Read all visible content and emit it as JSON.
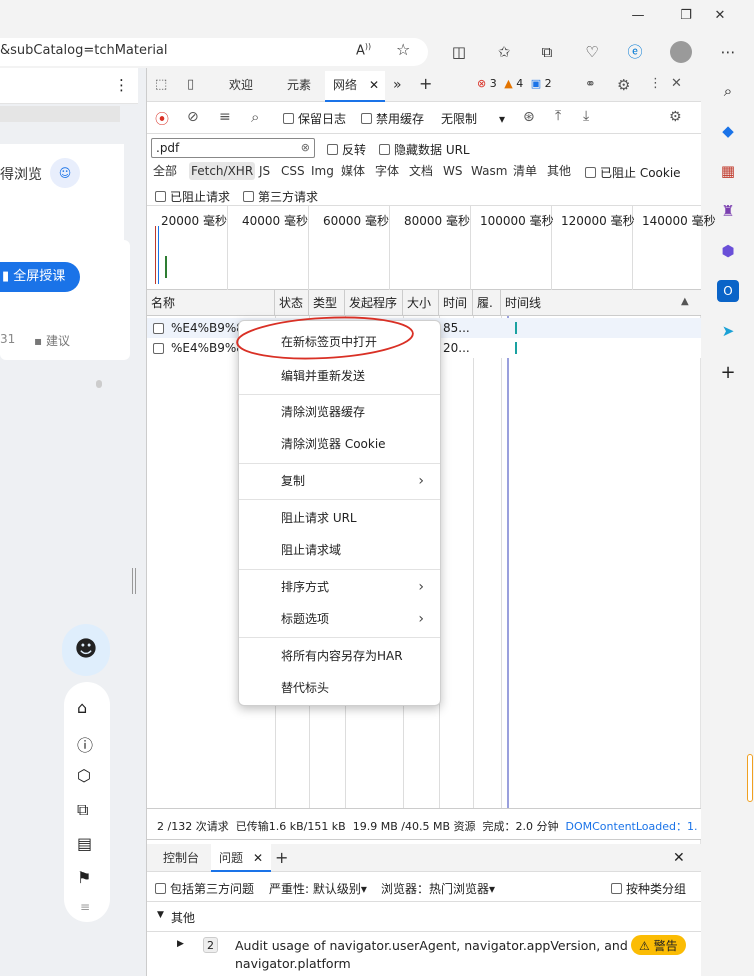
{
  "browser": {
    "address_url": "&subCatalog=tchMaterial",
    "read_aloud_label": "Aⁱ",
    "colors": {
      "accent": "#1a73e8",
      "edge_blue": "#0078d4"
    }
  },
  "left_page": {
    "browse_label": "得浏览",
    "fullscreen_button": "全屏授课",
    "count_label": "31",
    "suggest_label": "建议"
  },
  "devtools": {
    "tabs": [
      "欢迎",
      "元素",
      "网络"
    ],
    "more_tabs": "»",
    "add_tab": "+",
    "error_count": "3",
    "warning_count": "4",
    "info_count": "2",
    "toolbar": {
      "preserve_log": "保留日志",
      "disable_cache": "禁用缓存",
      "throttle": "无限制"
    },
    "filter": {
      "value": ".pdf",
      "invert": "反转",
      "hide_data_urls": "隐藏数据 URL",
      "types": [
        "全部",
        "Fetch/XHR",
        "JS",
        "CSS",
        "Img",
        "媒体",
        "字体",
        "文档",
        "WS",
        "Wasm",
        "清单",
        "其他"
      ],
      "blocked_cookies": "已阻止 Cookie",
      "blocked_requests": "已阻止请求",
      "third_party": "第三方请求"
    },
    "timeline_ticks": [
      "20000 毫秒",
      "40000 毫秒",
      "60000 毫秒",
      "80000 毫秒",
      "100000 毫秒",
      "120000 毫秒",
      "140000 毫秒"
    ],
    "columns": [
      "名称",
      "状态",
      "类型",
      "发起程序",
      "大小",
      "时间",
      "履.",
      "时间线"
    ],
    "rows": [
      {
        "name": "%E4%B9%89%",
        "time": "85..."
      },
      {
        "name": "%E4%B9%89%",
        "time": "20..."
      }
    ],
    "status_bar": {
      "requests": "2 /132 次请求",
      "transferred": "已传输1.6 kB/151 kB",
      "resources": "19.9 MB /40.5 MB 资源",
      "finish": "完成：2.0 分钟",
      "dcl": "DOMContentLoaded：1."
    },
    "drawer": {
      "tabs": [
        "控制台",
        "问题"
      ],
      "include_third_party": "包括第三方问题",
      "severity": "严重性: 默认级别▾",
      "browser_label": "浏览器：热门浏览器▾",
      "group_by_kind": "按种类分组",
      "section": "其他",
      "issue_count": "2",
      "issue_text_1": "Audit usage of navigator.userAgent, navigator.appVersion, and",
      "issue_text_2": "navigator.platform",
      "warning_badge": "警告"
    }
  },
  "context_menu": {
    "items": [
      {
        "label": "在新标签页中打开"
      },
      {
        "label": "编辑并重新发送"
      },
      {
        "label": "清除浏览器缓存"
      },
      {
        "label": "清除浏览器 Cookie"
      },
      {
        "label": "复制"
      },
      {
        "label": "阻止请求 URL"
      },
      {
        "label": "阻止请求域"
      },
      {
        "label": "排序方式"
      },
      {
        "label": "标题选项"
      },
      {
        "label": "将所有内容另存为HAR"
      },
      {
        "label": "替代标头"
      }
    ]
  }
}
